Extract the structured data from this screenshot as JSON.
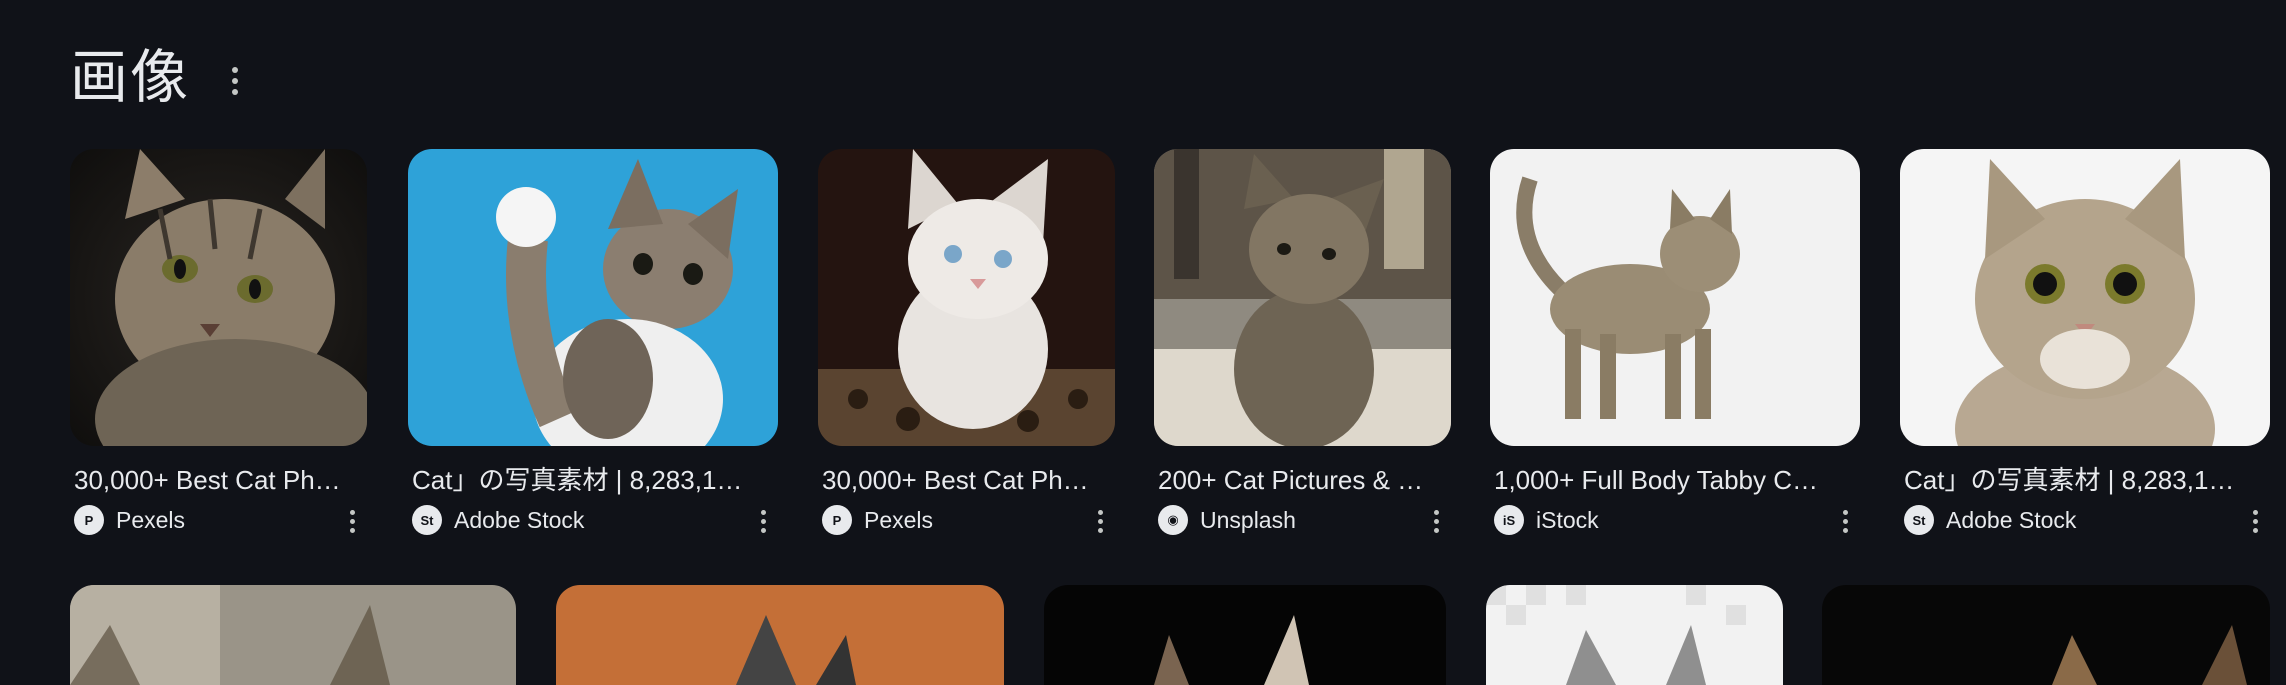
{
  "section": {
    "title": "画像"
  },
  "cards": [
    {
      "caption": "30,000+ Best Cat Ph…",
      "source": "Pexels",
      "source_icon": "pexels-icon"
    },
    {
      "caption": "Cat」の写真素材 | 8,283,1…",
      "source": "Adobe Stock",
      "source_icon": "adobe-stock-icon"
    },
    {
      "caption": "30,000+ Best Cat Ph…",
      "source": "Pexels",
      "source_icon": "pexels-icon"
    },
    {
      "caption": "200+ Cat Pictures & …",
      "source": "Unsplash",
      "source_icon": "unsplash-icon"
    },
    {
      "caption": "1,000+ Full Body Tabby C…",
      "source": "iStock",
      "source_icon": "istock-icon"
    },
    {
      "caption": "Cat」の写真素材 | 8,283,1…",
      "source": "Adobe Stock",
      "source_icon": "adobe-stock-icon"
    }
  ],
  "icon_glyphs": {
    "pexels": "P",
    "adobe": "St",
    "unsplash": "◉",
    "istock": "iS"
  }
}
